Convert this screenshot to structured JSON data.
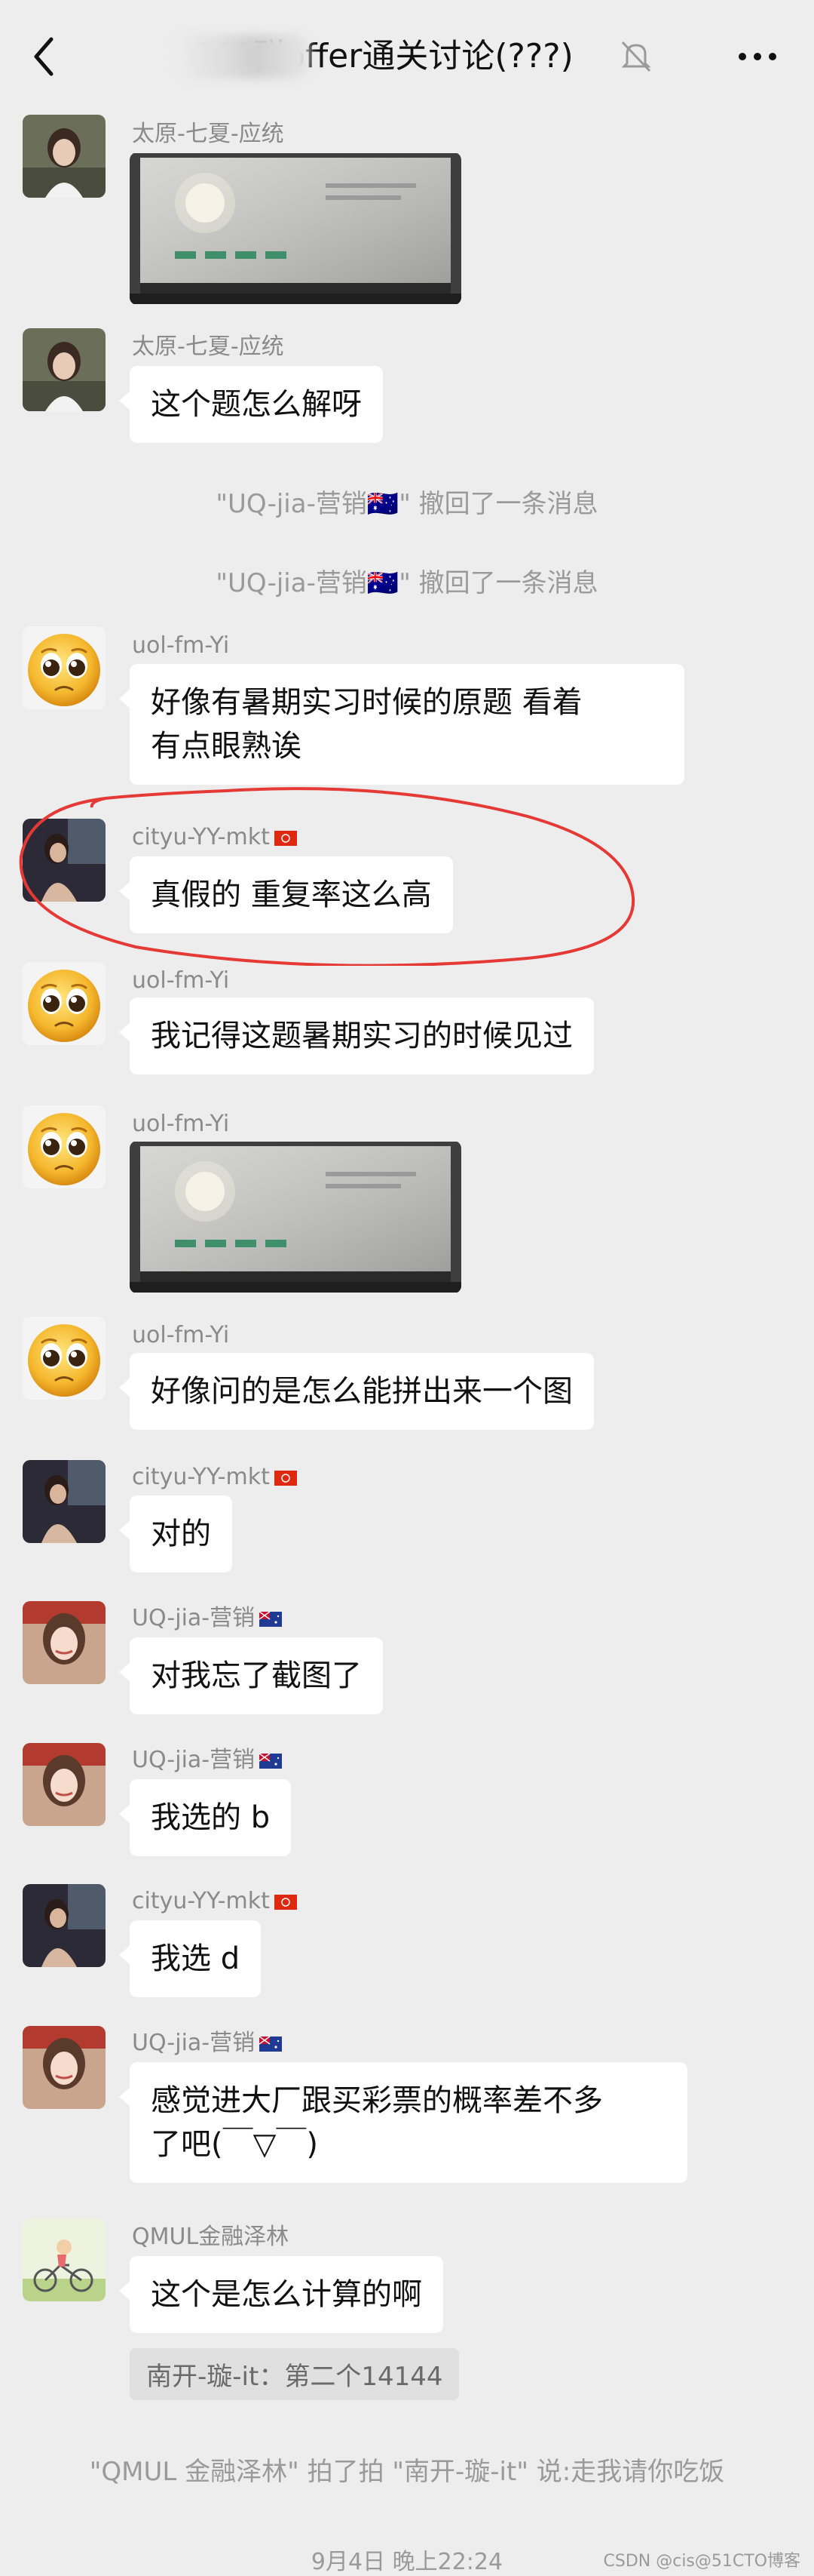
{
  "header": {
    "title": "2??群offer通关讨论(???)"
  },
  "messages": [
    {
      "name": "太原-七夏-应统",
      "type": "image"
    },
    {
      "name": "太原-七夏-应统",
      "text": "这个题怎么解呀"
    },
    {
      "system": "\"UQ-jia-营销🇦🇺\" 撤回了一条消息"
    },
    {
      "system": "\"UQ-jia-营销🇦🇺\" 撤回了一条消息"
    },
    {
      "name": "uol-fm-Yi",
      "text_line1": "好像有暑期实习时候的原题 看着",
      "text_line2": "有点眼熟诶"
    },
    {
      "name": "cityu-YY-mkt",
      "text": "真假的 重复率这么高"
    },
    {
      "name": "uol-fm-Yi",
      "text": "我记得这题暑期实习的时候见过"
    },
    {
      "name": "uol-fm-Yi",
      "type": "image"
    },
    {
      "name": "uol-fm-Yi",
      "text": "好像问的是怎么能拼出来一个图"
    },
    {
      "name": "cityu-YY-mkt",
      "text": "对的"
    },
    {
      "name": "UQ-jia-营销",
      "text": "对我忘了截图了"
    },
    {
      "name": "UQ-jia-营销",
      "text": "我选的 b"
    },
    {
      "name": "cityu-YY-mkt",
      "text": "我选 d"
    },
    {
      "name": "UQ-jia-营销",
      "text_line1": "感觉进大厂跟买彩票的概率差不多",
      "text_line2": "了吧(￣▽￣)"
    },
    {
      "name": "QMUL金融泽林",
      "text": "这个是怎么计算的啊",
      "quote": "南开-璇-it：第二个14144"
    },
    {
      "system": "\"QMUL 金融泽林\" 拍了拍 \"南开-璇-it\" 说:走我请你吃饭"
    }
  ],
  "timestamp": "9月4日 晚上22:24",
  "watermark": "CSDN @cis@51CTO博客",
  "colors": {
    "background": "#ededed",
    "bubble": "#ffffff",
    "annotation": "#e53935"
  },
  "icons": [
    "back-icon",
    "mute-bell-icon",
    "more-icon"
  ]
}
